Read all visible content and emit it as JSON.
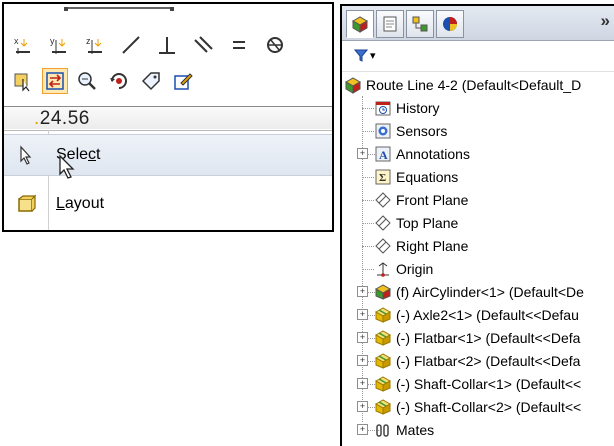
{
  "left_panel": {
    "dimension_value": "24.56",
    "menu": [
      {
        "label_pre": "Sele",
        "label_ul": "c",
        "label_post": "t"
      },
      {
        "label_pre": "",
        "label_ul": "L",
        "label_post": "ayout"
      }
    ]
  },
  "right_panel": {
    "overflow_chevron": "»",
    "filter_caret": "▾",
    "root_label": "Route Line 4-2  (Default<Default_D",
    "items": [
      {
        "label": "History"
      },
      {
        "label": "Sensors"
      },
      {
        "label": "Annotations"
      },
      {
        "label": "Equations"
      },
      {
        "label": "Front Plane"
      },
      {
        "label": "Top Plane"
      },
      {
        "label": "Right Plane"
      },
      {
        "label": "Origin"
      },
      {
        "label": "(f) AirCylinder<1> (Default<De"
      },
      {
        "label": "(-) Axle2<1> (Default<<Defau"
      },
      {
        "label": "(-) Flatbar<1> (Default<<Defa"
      },
      {
        "label": "(-) Flatbar<2> (Default<<Defa"
      },
      {
        "label": "(-) Shaft-Collar<1> (Default<<"
      },
      {
        "label": "(-) Shaft-Collar<2> (Default<<"
      },
      {
        "label": "Mates"
      }
    ]
  },
  "colors": {
    "selection_highlight": "#ffe9b0",
    "part_green": "#3c9a2a",
    "part_yellow": "#e6b800",
    "accent_orange": "#e8a000"
  }
}
